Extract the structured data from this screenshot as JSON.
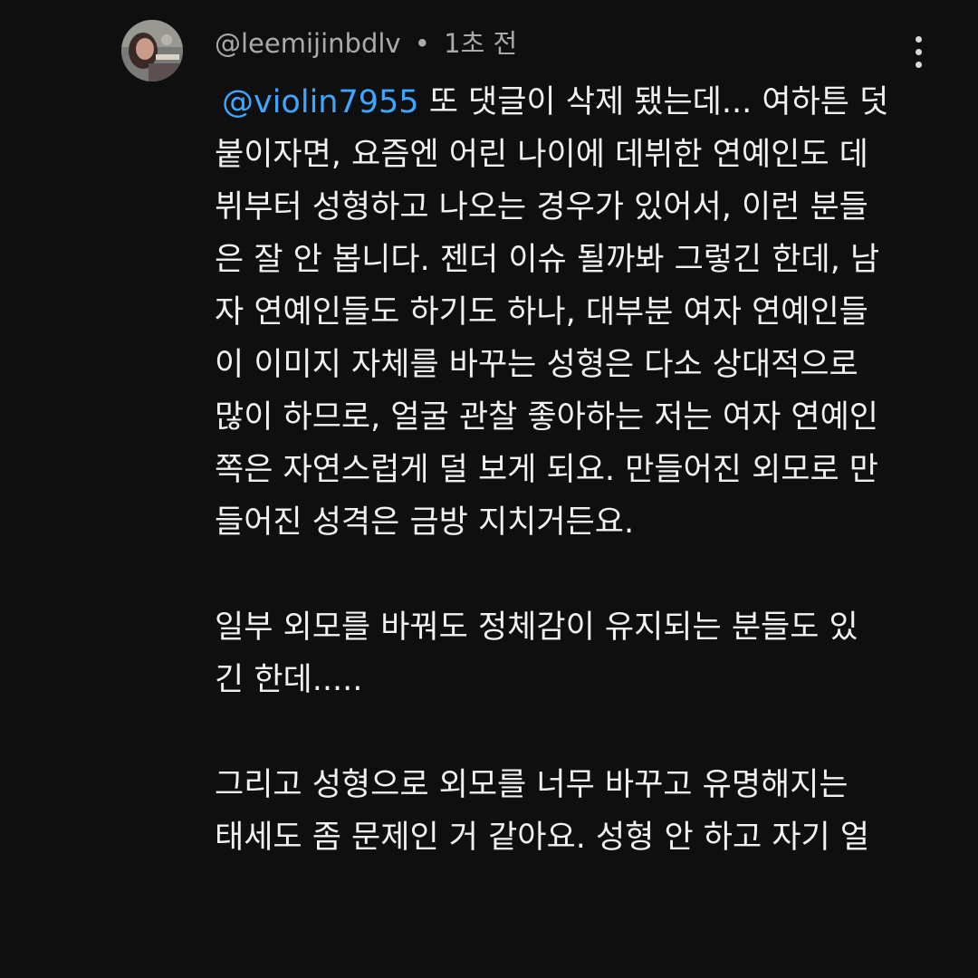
{
  "comment": {
    "author": "@leemijinbdlv",
    "separator": "•",
    "timestamp": "1초 전",
    "mention": "@violin7955",
    "lines": [
      " 또 댓글이 삭제 됐는데... 여하튼 덧",
      "붙이자면, 요즘엔 어린 나이에 데뷔한 연예인도 데",
      "뷔부터 성형하고 나오는 경우가 있어서, 이런 분들",
      "은 잘 안 봅니다. 젠더 이슈 될까봐 그렇긴 한데, 남",
      "자 연예인들도 하기도 하나, 대부분 여자 연예인들",
      "이 이미지 자체를 바꾸는 성형은 다소 상대적으로",
      "많이 하므로, 얼굴 관찰 좋아하는 저는 여자 연예인",
      "쪽은 자연스럽게 덜 보게 되요. 만들어진 외모로 만",
      "들어진 성격은 금방 지치거든요.",
      "",
      "일부 외모를 바꿔도 정체감이 유지되는 분들도 있",
      "긴 한데.....",
      "",
      "그리고 성형으로 외모를 너무 바꾸고 유명해지는",
      "태세도 좀 문제인 거 같아요. 성형 안 하고 자기 얼"
    ]
  },
  "colors": {
    "background": "#0f0f0f",
    "text": "#f1f1f1",
    "meta": "#aaaaaa",
    "mention": "#3ea6ff"
  },
  "icons": {
    "menu": "more-vert-icon",
    "avatar": "user-avatar"
  }
}
